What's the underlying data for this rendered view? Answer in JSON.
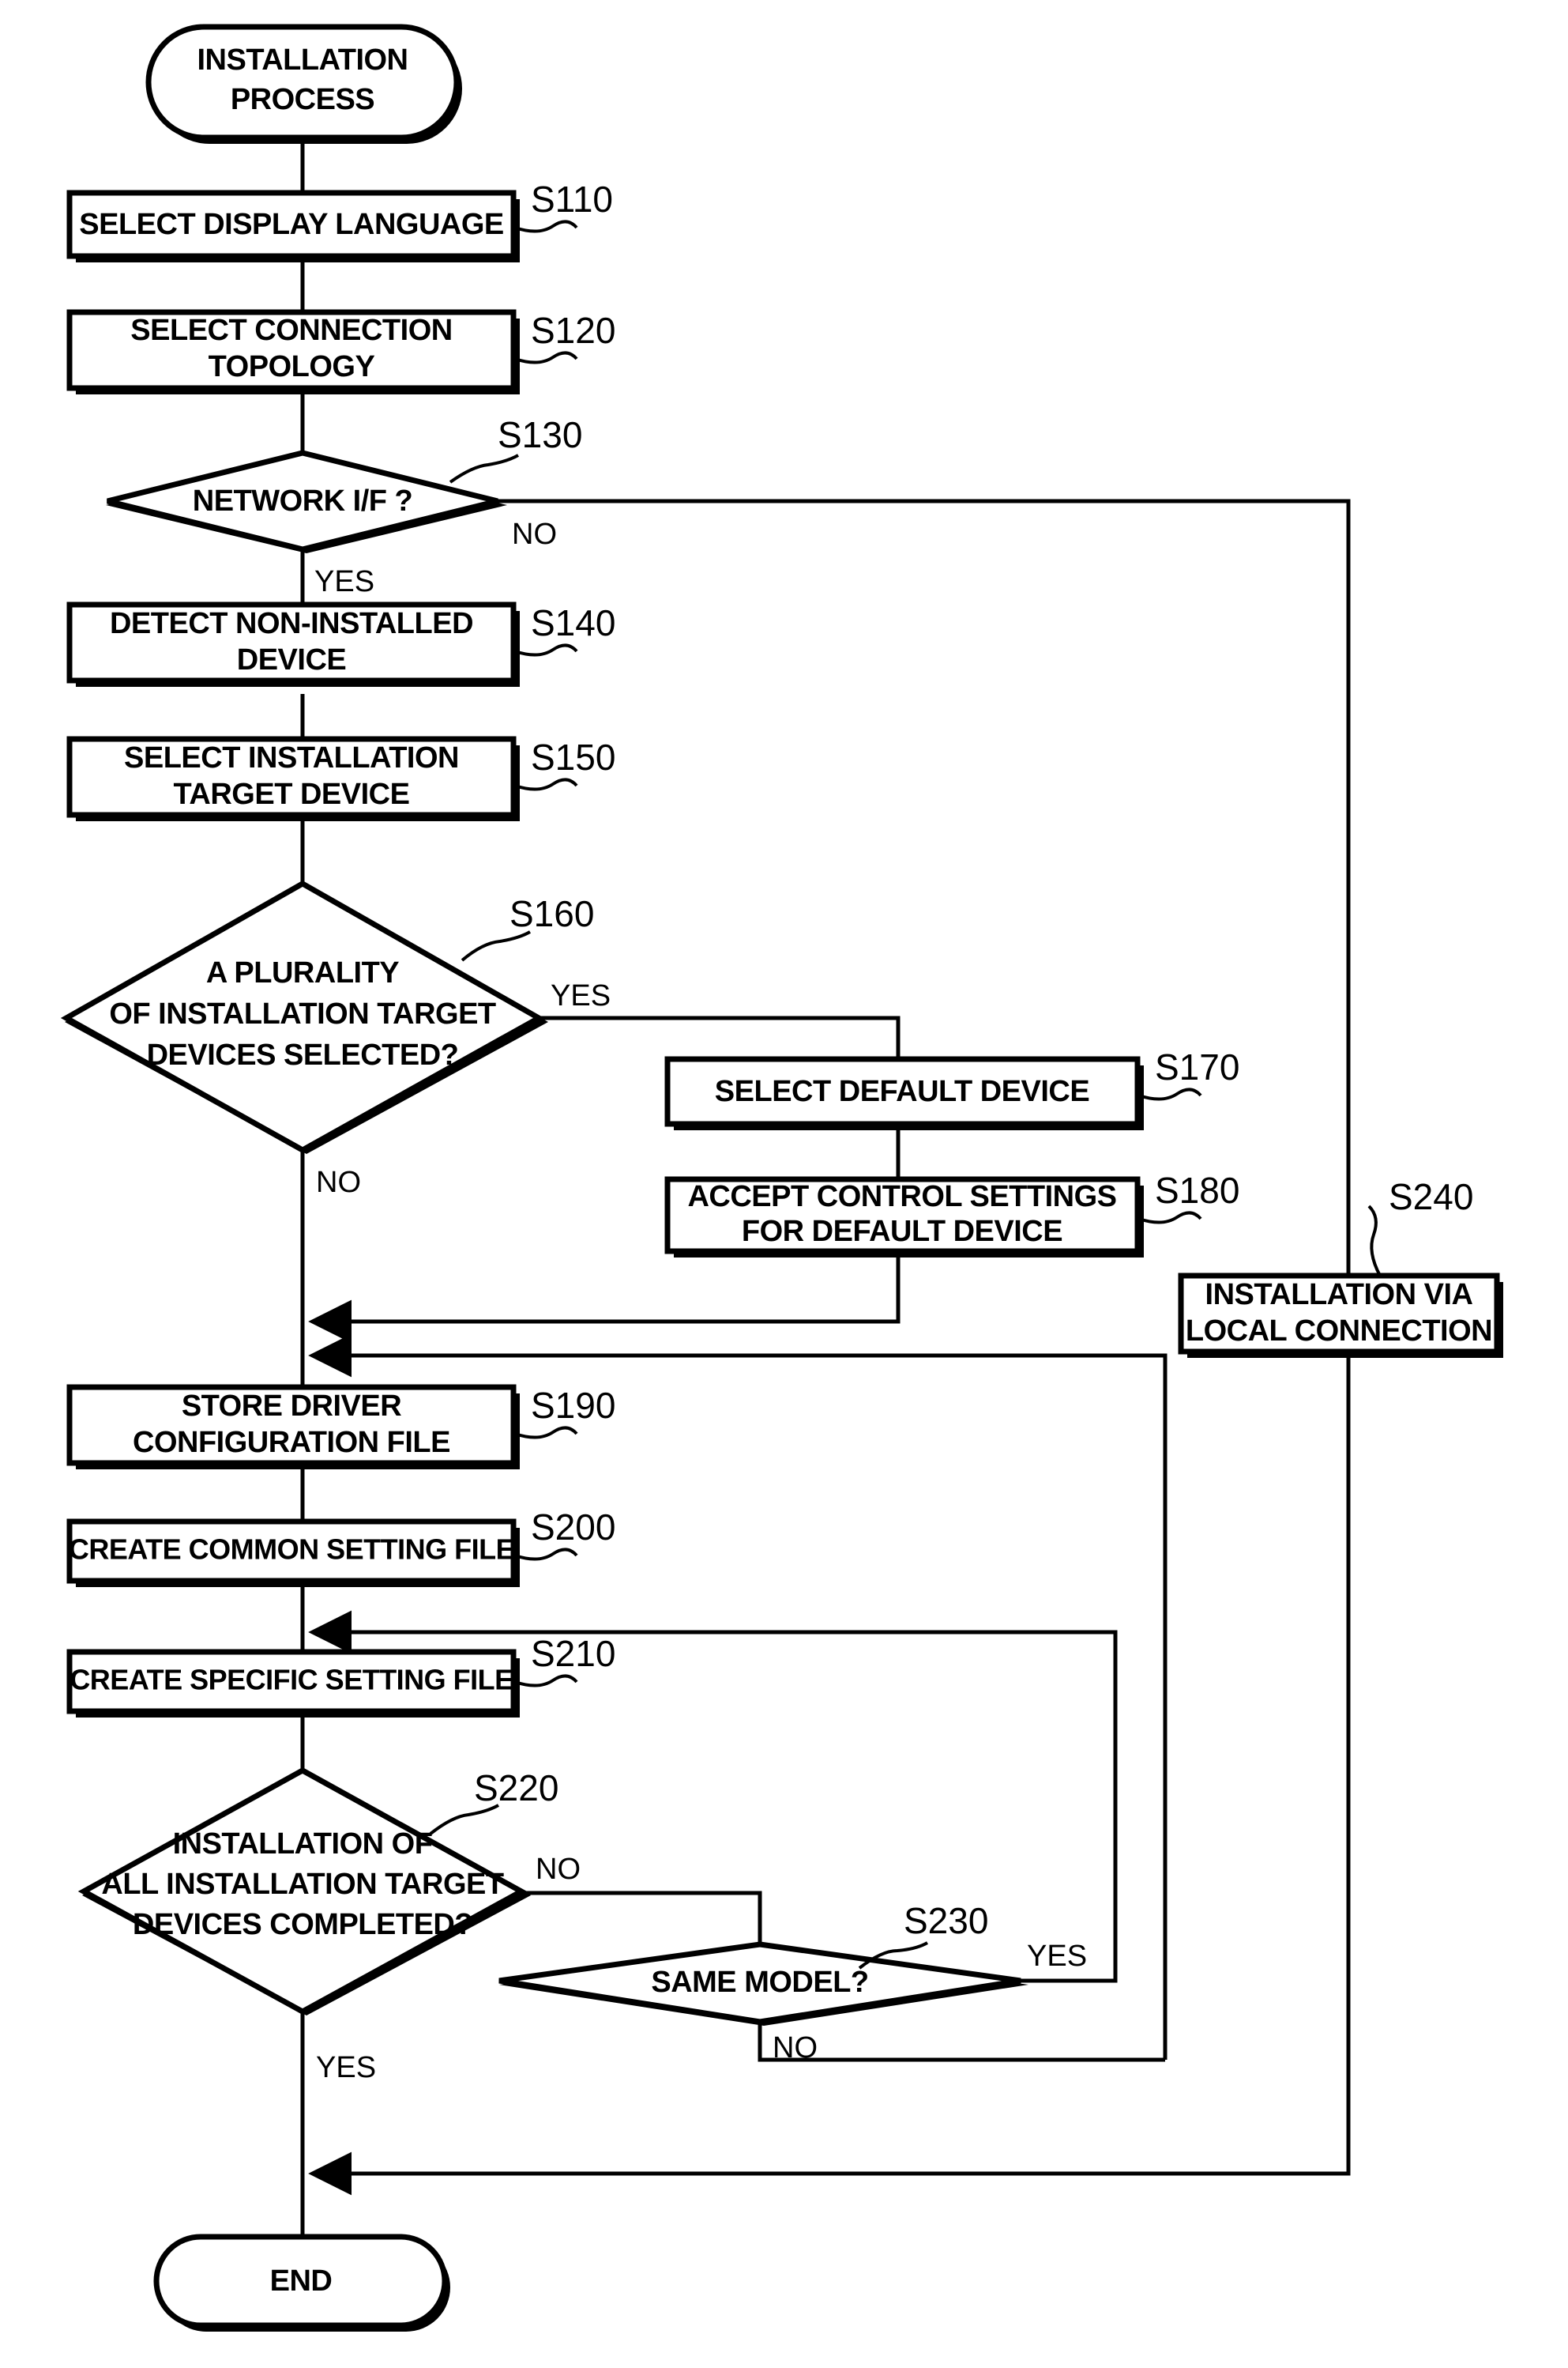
{
  "diagram": {
    "title": "INSTALLATION PROCESS FLOWCHART",
    "type": "flowchart",
    "orientation": "vertical",
    "colors": {
      "stroke": "#000000",
      "fill": "#ffffff",
      "text": "#000000"
    }
  },
  "nodes": {
    "start": {
      "shape": "terminator",
      "line1": "INSTALLATION",
      "line2": "PROCESS"
    },
    "s110": {
      "shape": "process",
      "step": "S110",
      "line1": "SELECT DISPLAY LANGUAGE",
      "line2": ""
    },
    "s120": {
      "shape": "process",
      "step": "S120",
      "line1": "SELECT CONNECTION",
      "line2": "TOPOLOGY"
    },
    "s130": {
      "shape": "decision",
      "step": "S130",
      "line1": "NETWORK I/F ?",
      "line2": "",
      "line3": ""
    },
    "s140": {
      "shape": "process",
      "step": "S140",
      "line1": "DETECT NON-INSTALLED",
      "line2": "DEVICE"
    },
    "s150": {
      "shape": "process",
      "step": "S150",
      "line1": "SELECT INSTALLATION",
      "line2": "TARGET DEVICE"
    },
    "s160": {
      "shape": "decision",
      "step": "S160",
      "line1": "A PLURALITY",
      "line2": "OF INSTALLATION TARGET",
      "line3": "DEVICES SELECTED?"
    },
    "s170": {
      "shape": "process",
      "step": "S170",
      "line1": "SELECT DEFAULT DEVICE",
      "line2": ""
    },
    "s180": {
      "shape": "process",
      "step": "S180",
      "line1": "ACCEPT CONTROL SETTINGS",
      "line2": "FOR DEFAULT DEVICE"
    },
    "s190": {
      "shape": "process",
      "step": "S190",
      "line1": "STORE DRIVER",
      "line2": "CONFIGURATION FILE"
    },
    "s200": {
      "shape": "process",
      "step": "S200",
      "line1": "CREATE COMMON SETTING FILE",
      "line2": ""
    },
    "s210": {
      "shape": "process",
      "step": "S210",
      "line1": "CREATE SPECIFIC SETTING FILE",
      "line2": ""
    },
    "s220": {
      "shape": "decision",
      "step": "S220",
      "line1": "INSTALLATION OF",
      "line2": "ALL INSTALLATION TARGET",
      "line3": "DEVICES COMPLETED?"
    },
    "s230": {
      "shape": "decision",
      "step": "S230",
      "line1": "SAME MODEL?",
      "line2": "",
      "line3": ""
    },
    "s240": {
      "shape": "process",
      "step": "S240",
      "line1": "INSTALLATION VIA",
      "line2": "LOCAL CONNECTION"
    },
    "end": {
      "shape": "terminator",
      "line1": "END",
      "line2": ""
    }
  },
  "branch_labels": {
    "s130_no": "NO",
    "s130_yes": "YES",
    "s160_yes": "YES",
    "s160_no": "NO",
    "s220_no": "NO",
    "s220_yes": "YES",
    "s230_yes": "YES",
    "s230_no": "NO"
  },
  "edges": [
    {
      "from": "start",
      "to": "s110",
      "label": ""
    },
    {
      "from": "s110",
      "to": "s120",
      "label": ""
    },
    {
      "from": "s120",
      "to": "s130",
      "label": ""
    },
    {
      "from": "s130",
      "to": "s140",
      "label": "YES"
    },
    {
      "from": "s130",
      "to": "s240",
      "label": "NO"
    },
    {
      "from": "s140",
      "to": "s150",
      "label": ""
    },
    {
      "from": "s150",
      "to": "s160",
      "label": ""
    },
    {
      "from": "s160",
      "to": "s170",
      "label": "YES"
    },
    {
      "from": "s160",
      "to": "s190",
      "label": "NO"
    },
    {
      "from": "s170",
      "to": "s180",
      "label": ""
    },
    {
      "from": "s180",
      "to": "s190",
      "label": ""
    },
    {
      "from": "s190",
      "to": "s200",
      "label": ""
    },
    {
      "from": "s200",
      "to": "s210",
      "label": ""
    },
    {
      "from": "s210",
      "to": "s220",
      "label": ""
    },
    {
      "from": "s220",
      "to": "s230",
      "label": "NO"
    },
    {
      "from": "s220",
      "to": "end",
      "label": "YES"
    },
    {
      "from": "s230",
      "to": "s210",
      "label": "YES"
    },
    {
      "from": "s230",
      "to": "s190",
      "label": "NO"
    },
    {
      "from": "s240",
      "to": "end",
      "label": ""
    }
  ]
}
